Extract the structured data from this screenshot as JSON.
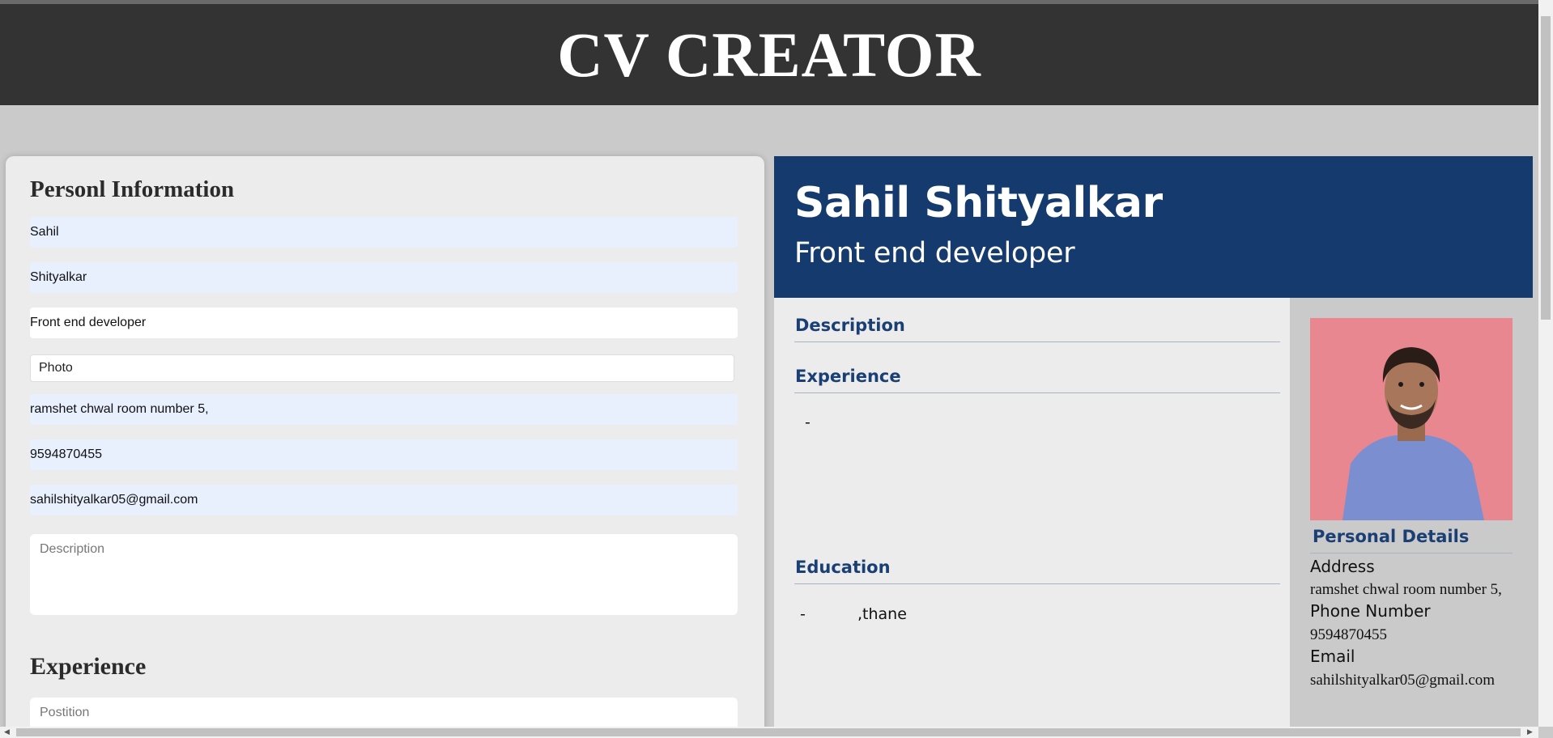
{
  "header": {
    "title": "CV CREATOR"
  },
  "form": {
    "section_personal": "Personl Information",
    "first_name": "Sahil",
    "last_name": "Shityalkar",
    "job_title": "Front end developer",
    "photo_label": "Photo",
    "address": "ramshet chwal room number 5,",
    "phone": "9594870455",
    "email": "sahilshityalkar05@gmail.com",
    "description_placeholder": "Description",
    "section_experience": "Experience",
    "position_placeholder": "Postition"
  },
  "cv": {
    "name": "Sahil Shityalkar",
    "title": "Front end developer",
    "description_heading": "Description",
    "experience_heading": "Experience",
    "experience_entry": "-",
    "education_heading": "Education",
    "education_dash": "-",
    "education_entry": ",thane",
    "personal_details_heading": "Personal Details",
    "address_label": "Address",
    "address_value": "ramshet chwal room number 5,",
    "phone_label": "Phone Number",
    "phone_value": "9594870455",
    "email_label": "Email",
    "email_value": "sahilshityalkar05@gmail.com"
  },
  "colors": {
    "header_bg": "#333333",
    "cv_header_bg": "#143a6e",
    "accent_text": "#1a3f75",
    "photo_bg": "#e8878f"
  }
}
